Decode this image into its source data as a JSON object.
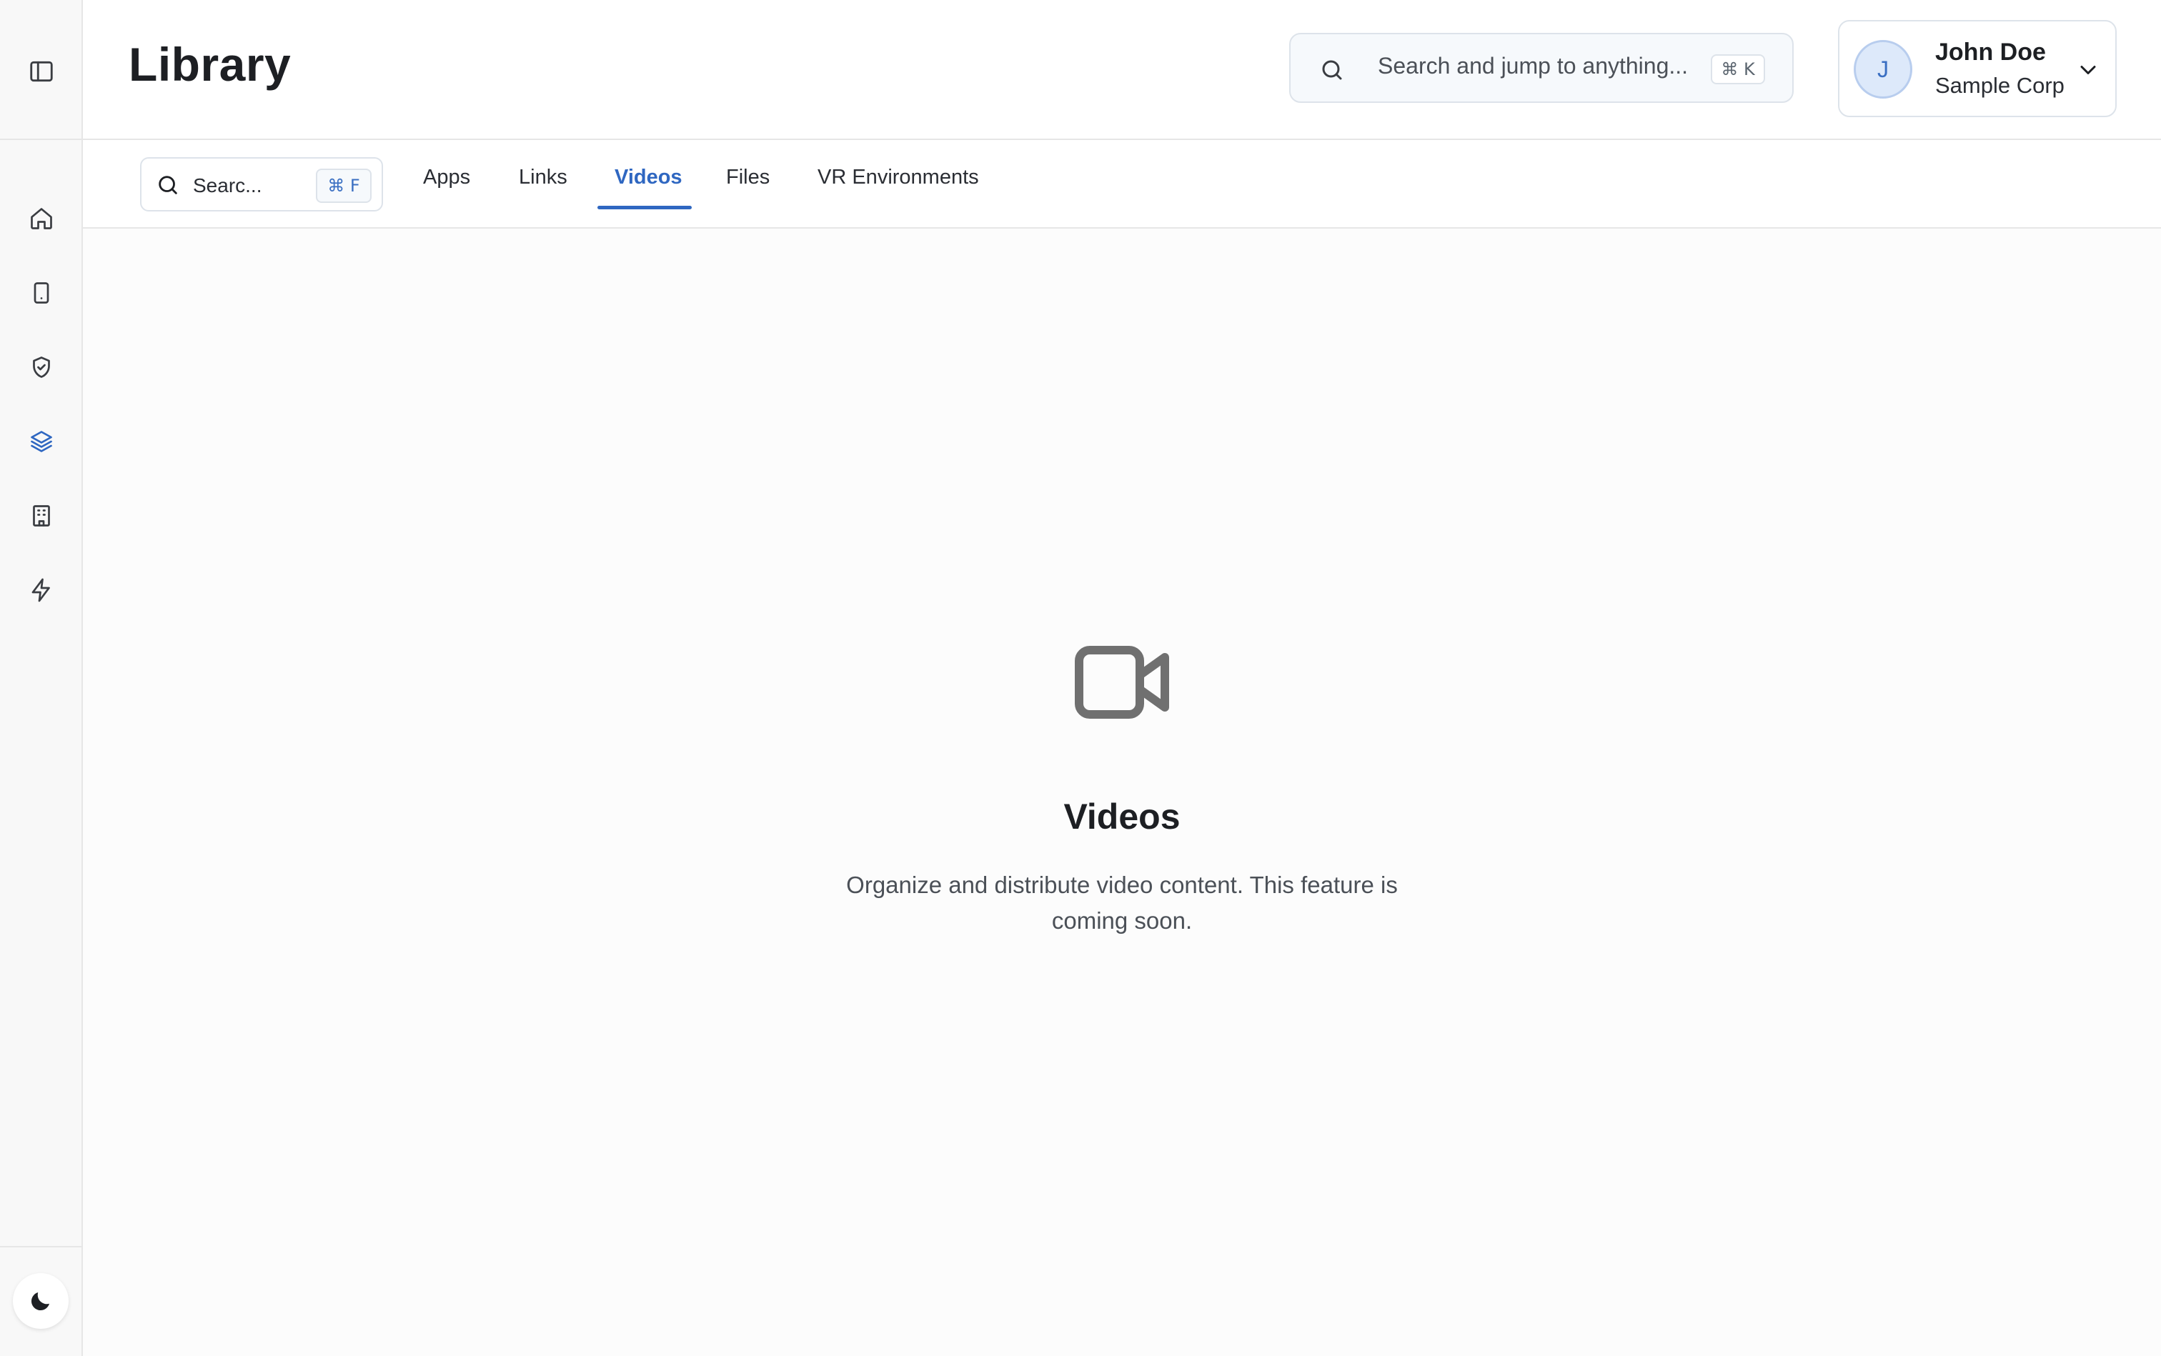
{
  "page": {
    "title": "Library"
  },
  "header": {
    "search": {
      "placeholder": "Search and jump to anything...",
      "shortcut": "⌘ K"
    },
    "user": {
      "initial": "J",
      "name": "John Doe",
      "org": "Sample Corp"
    }
  },
  "sidebar": {
    "items": [
      {
        "name": "home",
        "icon": "home-icon"
      },
      {
        "name": "devices",
        "icon": "tablet-icon"
      },
      {
        "name": "security",
        "icon": "shield-check-icon"
      },
      {
        "name": "library",
        "icon": "layers-icon",
        "active": true
      },
      {
        "name": "organization",
        "icon": "building-icon"
      },
      {
        "name": "automations",
        "icon": "zap-icon"
      }
    ],
    "theme_toggle_icon": "moon-icon"
  },
  "tabs": {
    "search": {
      "placeholder": "Searc...",
      "shortcut": "⌘ F"
    },
    "items": [
      {
        "label": "Apps"
      },
      {
        "label": "Links"
      },
      {
        "label": "Videos",
        "active": true
      },
      {
        "label": "Files"
      },
      {
        "label": "VR Environments"
      }
    ]
  },
  "empty_state": {
    "icon": "video-camera-icon",
    "title": "Videos",
    "description": "Organize and distribute video content. This feature is coming soon."
  },
  "colors": {
    "accent": "#2f67c1",
    "text": "#1d1f23",
    "muted": "#4b5057",
    "icon": "#555555"
  }
}
